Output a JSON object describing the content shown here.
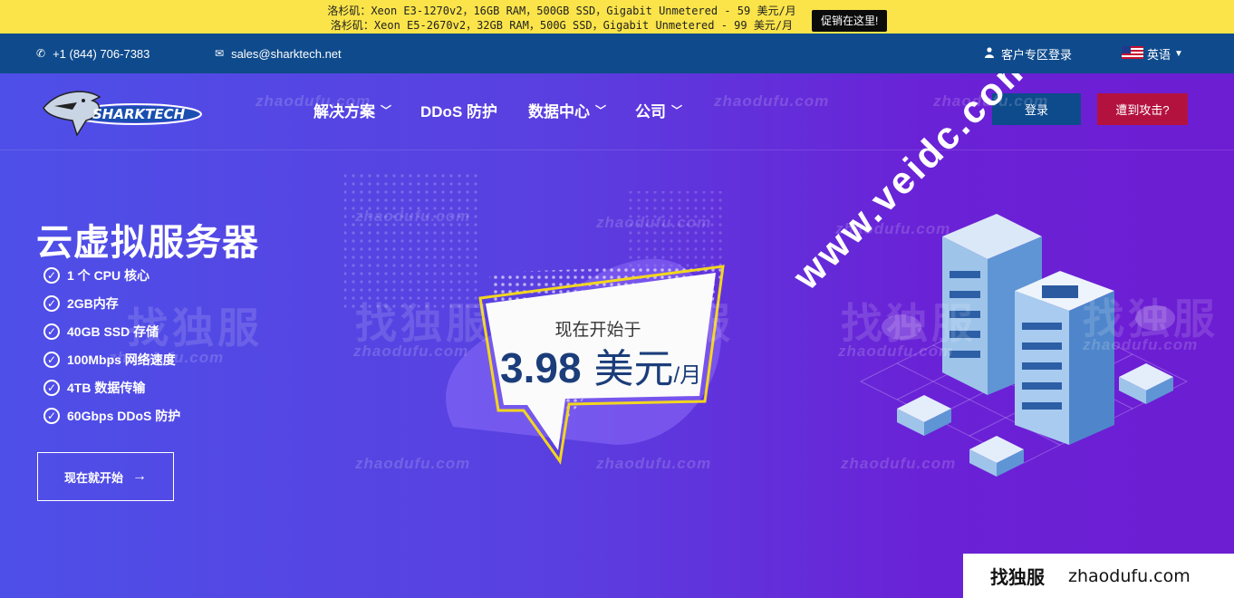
{
  "promo": {
    "line1": "洛杉矶：Xeon E3-1270v2，16GB RAM，500GB SSD，Gigabit Unmetered - 59 美元/月",
    "line2": "洛杉矶：Xeon E5-2670v2，32GB RAM，500G SSD，Gigabit Unmetered - 99 美元/月",
    "button": "促销在这里!",
    "bg_color": "#fbe44a"
  },
  "topbar": {
    "phone": "+1 (844) 706-7383",
    "email": "sales@sharktech.net",
    "client_login": "客户专区登录",
    "language": "英语",
    "bg_color": "#0f4b8c"
  },
  "header": {
    "logo_text": "SHARKTECH",
    "nav": [
      {
        "label": "解决方案",
        "dropdown": true
      },
      {
        "label": "DDoS 防护",
        "dropdown": false
      },
      {
        "label": "数据中心",
        "dropdown": true
      },
      {
        "label": "公司",
        "dropdown": true
      }
    ],
    "login_button": "登录",
    "attack_button": "遭到攻击?",
    "attack_color": "#b3123f"
  },
  "hero": {
    "title": "云虚拟服务器",
    "features": [
      "1 个 CPU 核心",
      "2GB内存",
      "40GB SSD 存储",
      "100Mbps 网络速度",
      "4TB 数据传输",
      "60Gbps DDoS 防护"
    ],
    "cta": "现在就开始",
    "price_prefix": "现在开始于",
    "price_value": "3.98",
    "price_currency": "美元",
    "price_period": "/月"
  },
  "watermarks": {
    "site": "zhaodufu.com",
    "cn": "找独服",
    "veidc": "www.veidc.com"
  },
  "footer_watermark": {
    "cn": "找独服",
    "en": "zhaodufu.com"
  }
}
